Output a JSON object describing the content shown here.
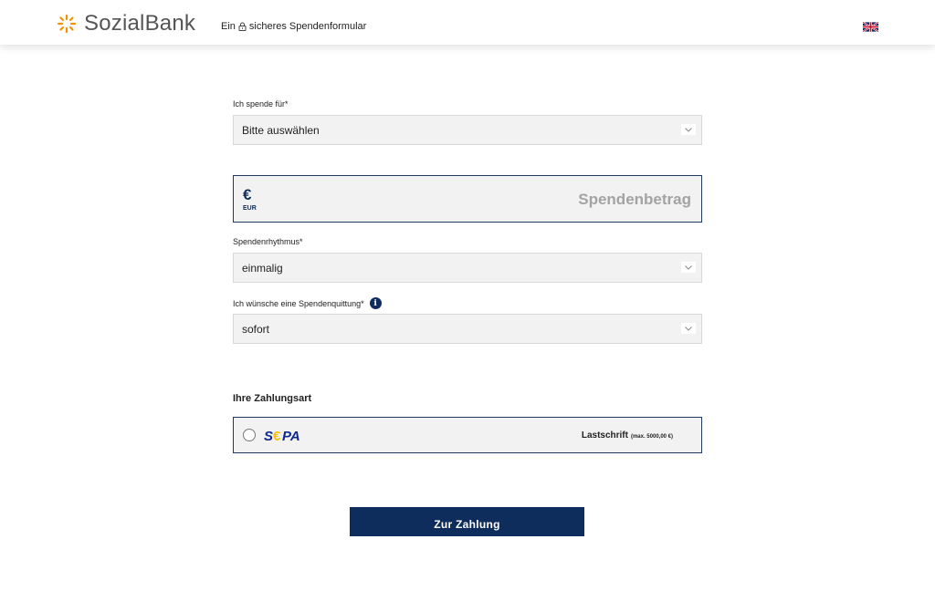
{
  "header": {
    "logo_text": "SozialBank",
    "tagline_before": "Ein",
    "tagline_after": "sicheres Spendenformular",
    "language_flag": "uk-flag-icon"
  },
  "form": {
    "purpose": {
      "label": "Ich spende für*",
      "value": "Bitte auswählen"
    },
    "amount": {
      "currency_symbol": "€",
      "currency_code": "EUR",
      "placeholder": "Spendenbetrag"
    },
    "rhythm": {
      "label": "Spendenrhythmus*",
      "value": "einmalig"
    },
    "receipt": {
      "label": "Ich wünsche eine Spendenquittung*",
      "value": "sofort",
      "info_icon": "i"
    },
    "payment": {
      "section_title": "Ihre Zahlungsart",
      "method_logo": "SEPA",
      "method_label": "Lastschrift",
      "method_note": "(max. 5000,00 €)"
    },
    "submit_label": "Zur Zahlung"
  },
  "colors": {
    "brand_navy": "#0f2d5c",
    "accent_orange": "#f39200",
    "field_bg": "#f2f2f2"
  }
}
